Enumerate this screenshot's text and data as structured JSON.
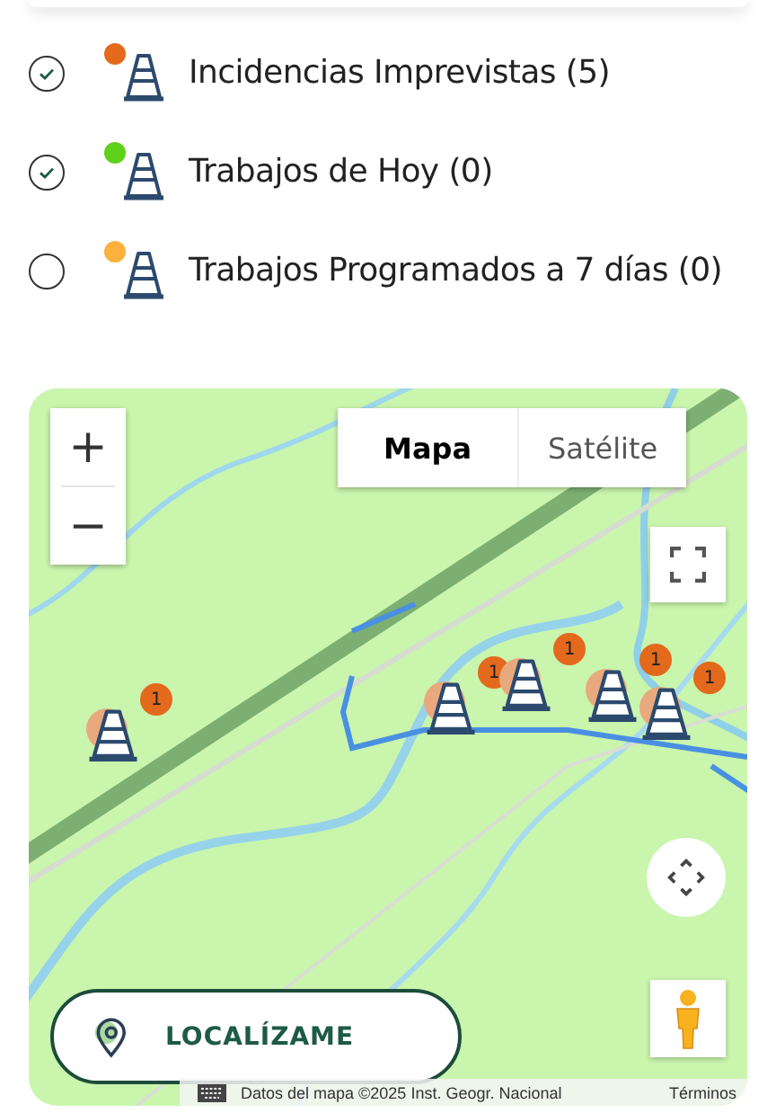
{
  "layers": [
    {
      "label": "Incidencias Imprevistas (5)",
      "checked": true,
      "color": "#e3691d"
    },
    {
      "label": "Trabajos de Hoy (0)",
      "checked": true,
      "color": "#5ed11a"
    },
    {
      "label": "Trabajos Programados a 7 días (0)",
      "checked": false,
      "color": "#fbb13c"
    }
  ],
  "map": {
    "map_types": [
      {
        "label": "Mapa",
        "selected": true
      },
      {
        "label": "Satélite",
        "selected": false
      }
    ],
    "zoom_in": "+",
    "zoom_out": "−",
    "markers": [
      {
        "count": "1"
      },
      {
        "count": "1"
      },
      {
        "count": "1"
      },
      {
        "count": "1"
      },
      {
        "count": "1"
      }
    ],
    "locate_button": "LOCALÍZAME",
    "attribution": "Datos del mapa ©2025 Inst. Geogr. Nacional",
    "terms": "Términos"
  }
}
